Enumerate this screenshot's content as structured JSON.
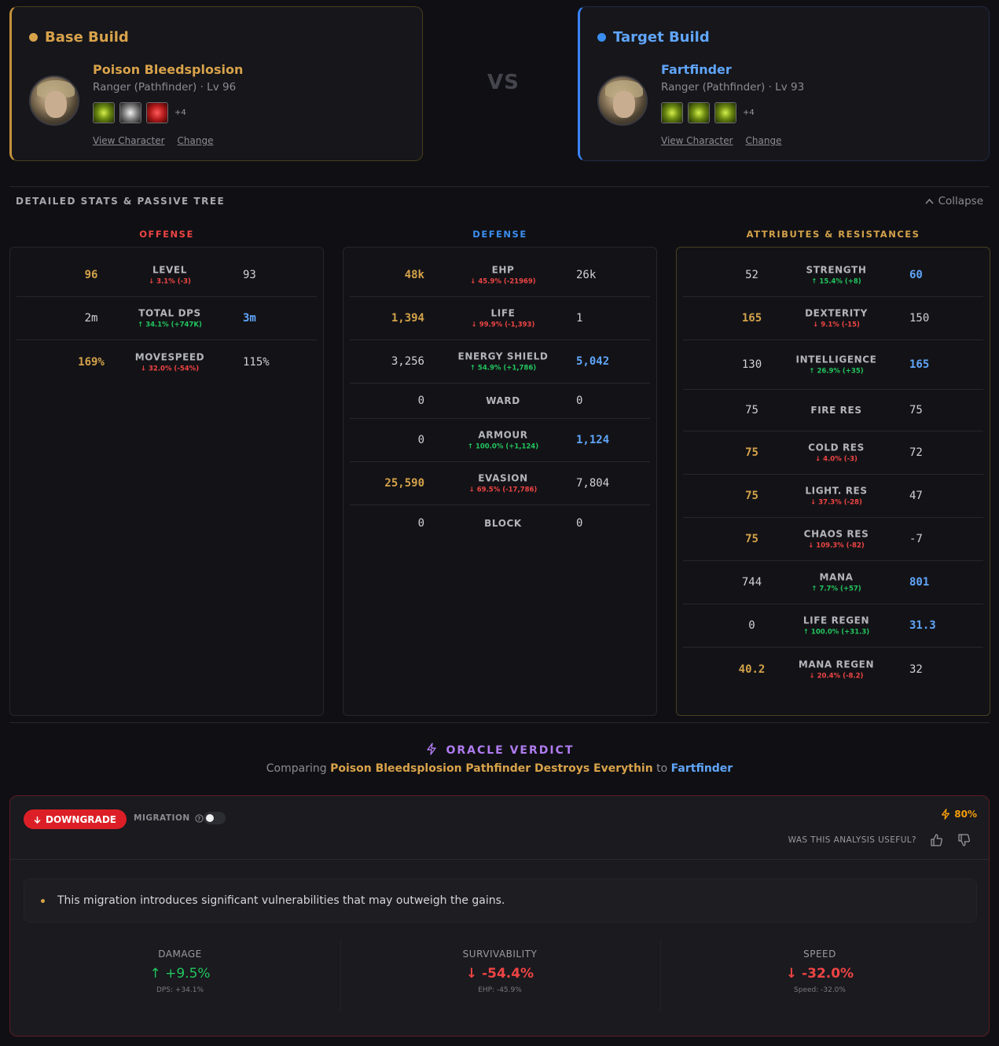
{
  "base": {
    "title": "Base Build",
    "name": "Poison Bleedsplosion",
    "sub": "Ranger (Pathfinder) · Lv 96",
    "more": "+4",
    "view": "View Character",
    "change": "Change"
  },
  "target": {
    "title": "Target Build",
    "name": "Fartfinder",
    "sub": "Ranger (Pathfinder) · Lv 93",
    "more": "+4",
    "view": "View Character",
    "change": "Change"
  },
  "vs": "VS",
  "section": {
    "title": "DETAILED STATS & PASSIVE TREE",
    "collapse": "Collapse"
  },
  "heads": {
    "offense": "OFFENSE",
    "defense": "DEFENSE",
    "attributes": "ATTRIBUTES & RESISTANCES"
  },
  "offense": [
    {
      "label": "LEVEL",
      "left": "96",
      "right": "93",
      "delta": "↓ 3.1% (-3)"
    },
    {
      "label": "TOTAL DPS",
      "left": "2m",
      "right": "3m",
      "delta": "↑ 34.1% (+747K)"
    },
    {
      "label": "MOVESPEED",
      "left": "169%",
      "right": "115%",
      "delta": "↓ 32.0% (-54%)"
    }
  ],
  "defense": [
    {
      "label": "EHP",
      "left": "48k",
      "right": "26k",
      "delta": "↓ 45.9% (-21969)"
    },
    {
      "label": "LIFE",
      "left": "1,394",
      "right": "1",
      "delta": "↓ 99.9% (-1,393)"
    },
    {
      "label": "ENERGY SHIELD",
      "left": "3,256",
      "right": "5,042",
      "delta": "↑ 54.9% (+1,786)"
    },
    {
      "label": "WARD",
      "left": "0",
      "right": "0",
      "delta": ""
    },
    {
      "label": "ARMOUR",
      "left": "0",
      "right": "1,124",
      "delta": "↑ 100.0% (+1,124)"
    },
    {
      "label": "EVASION",
      "left": "25,590",
      "right": "7,804",
      "delta": "↓ 69.5% (-17,786)"
    },
    {
      "label": "BLOCK",
      "left": "0",
      "right": "0",
      "delta": ""
    }
  ],
  "attributes": [
    {
      "label": "STRENGTH",
      "left": "52",
      "right": "60",
      "delta": "↑ 15.4% (+8)"
    },
    {
      "label": "DEXTERITY",
      "left": "165",
      "right": "150",
      "delta": "↓ 9.1% (-15)"
    },
    {
      "label": "INTELLIGENCE",
      "left": "130",
      "right": "165",
      "delta": "↑ 26.9% (+35)"
    },
    {
      "label": "FIRE RES",
      "left": "75",
      "right": "75",
      "delta": ""
    },
    {
      "label": "COLD RES",
      "left": "75",
      "right": "72",
      "delta": "↓ 4.0% (-3)"
    },
    {
      "label": "LIGHT. RES",
      "left": "75",
      "right": "47",
      "delta": "↓ 37.3% (-28)"
    },
    {
      "label": "CHAOS RES",
      "left": "75",
      "right": "-7",
      "delta": "↓ 109.3% (-82)"
    },
    {
      "label": "MANA",
      "left": "744",
      "right": "801",
      "delta": "↑ 7.7% (+57)"
    },
    {
      "label": "LIFE REGEN",
      "left": "0",
      "right": "31.3",
      "delta": "↑ 100.0% (+31.3)"
    },
    {
      "label": "MANA REGEN",
      "left": "40.2",
      "right": "32",
      "delta": "↓ 20.4% (-8.2)"
    }
  ],
  "verdict": {
    "title": "ORACLE VERDICT",
    "comparing": "Comparing",
    "base_name": "Poison Bleedsplosion Pathfinder Destroys Everythin",
    "to": "to",
    "target_name": "Fartfinder",
    "badge": "DOWNGRADE",
    "migration": "MIGRATION",
    "confidence": "80%",
    "useful": "WAS THIS ANALYSIS USEFUL?",
    "summary": "This migration introduces significant vulnerabilities that may outweigh the gains.",
    "metrics": [
      {
        "label": "DAMAGE",
        "value": "↑ +9.5%",
        "sub": "DPS: +34.1%"
      },
      {
        "label": "SURVIVABILITY",
        "value": "↓ -54.4%",
        "sub": "EHP: -45.9%"
      },
      {
        "label": "SPEED",
        "value": "↓ -32.0%",
        "sub": "Speed: -32.0%"
      }
    ]
  },
  "colors": {
    "gold": "#d4a24a",
    "blue": "#60a5fa",
    "up": "#22c55e",
    "down": "#ef4444",
    "purple": "#b07cf0",
    "red_badge": "#dc1f26"
  }
}
